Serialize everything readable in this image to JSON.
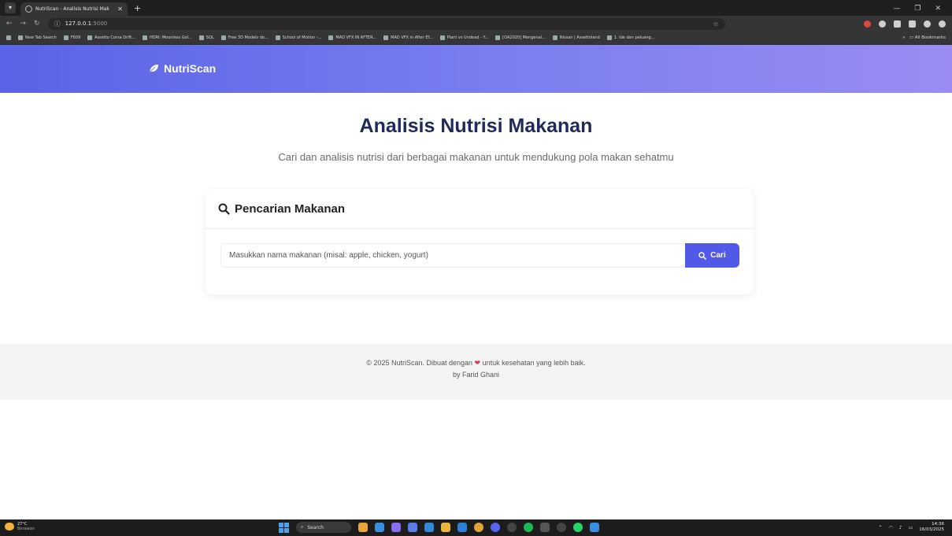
{
  "browser": {
    "tab_title": "NutriScan - Analisis Nutrisi Mak",
    "url_host": "127.0.0.1",
    "url_port": ":5000",
    "bookmarks": [
      "New Tab Search",
      "F609",
      "Assetto Corsa Drift...",
      "HDRI: Moonless Gol...",
      "SQL",
      "Free 3D Models do...",
      "School of Motion -...",
      "MAD VFX IN AFTER...",
      "MAD VFX in After Ef...",
      "Plant vs Undead - Y...",
      "[OA2020] Mengenal...",
      "Nissan | Assettoland",
      "1. Ide dan peluang..."
    ],
    "bookmarks_more": "»",
    "all_bookmarks": "All Bookmarks"
  },
  "navbar": {
    "brand": "NutriScan"
  },
  "hero": {
    "title": "Analisis Nutrisi Makanan",
    "subtitle": "Cari dan analisis nutrisi dari berbagai makanan untuk mendukung pola makan sehatmu"
  },
  "search_card": {
    "title": "Pencarian Makanan",
    "input_placeholder": "Masukkan nama makanan (misal: apple, chicken, yogurt)",
    "button_label": "Cari"
  },
  "footer": {
    "text_before_heart": "© 2025 NutriScan. Dibuat dengan",
    "text_after_heart": "untuk kesehatan yang lebih baik.",
    "credit": "by Farid Ghani"
  },
  "taskbar": {
    "weather_temp": "27°C",
    "weather_desc": "Berawan",
    "search_label": "Search",
    "time": "14:36",
    "date": "16/03/2025"
  },
  "colors": {
    "navbar_start": "#5b63e6",
    "navbar_end": "#9a8cf2",
    "title": "#1f2a5a",
    "button": "#5258e8",
    "heart": "#d93a3a"
  }
}
